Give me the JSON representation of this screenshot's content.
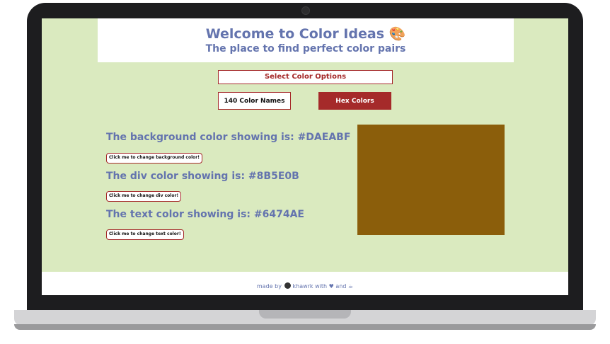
{
  "header": {
    "title": "Welcome to Color Ideas 🎨",
    "subtitle": "The place to find perfect color pairs"
  },
  "options": {
    "select_label": "Select Color Options",
    "names_label": "140 Color Names",
    "hex_label": "Hex Colors"
  },
  "colors": {
    "background_text": "The background color showing is: #DAEABF",
    "background_button": "Click me to change background color!",
    "div_text": "The div color showing is: #8B5E0B",
    "div_button": "Click me to change div color!",
    "text_text": "The text color showing is: #6474AE",
    "text_button": "Click me to change text color!",
    "background_hex": "#DAEABF",
    "div_hex": "#8B5E0B",
    "text_hex": "#6474AE",
    "accent_hex": "#A52A2A"
  },
  "footer": {
    "made_by": "made by",
    "author": "khawrk",
    "with_text": "with ♥ and ☕",
    "github_icon": "github-icon"
  }
}
